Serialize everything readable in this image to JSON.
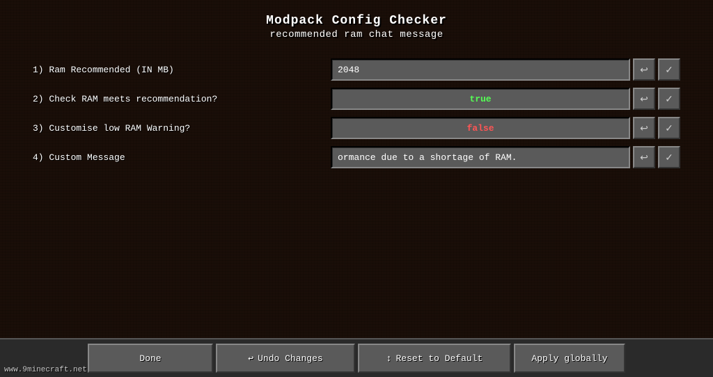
{
  "header": {
    "title": "Modpack Config Checker",
    "subtitle": "recommended ram chat message"
  },
  "rows": [
    {
      "id": "row1",
      "label": "1) Ram Recommended (IN MB)",
      "value": "2048",
      "type": "text",
      "valueClass": ""
    },
    {
      "id": "row2",
      "label": "2) Check RAM meets recommendation?",
      "value": "true",
      "type": "toggle",
      "valueClass": "value-true"
    },
    {
      "id": "row3",
      "label": "3) Customise low RAM Warning?",
      "value": "false",
      "type": "toggle",
      "valueClass": "value-false"
    },
    {
      "id": "row4",
      "label": "4) Custom Message",
      "value": "ormance due to a shortage of RAM.",
      "type": "text",
      "valueClass": ""
    }
  ],
  "buttons": {
    "done": "Done",
    "undo": "Undo Changes",
    "reset": "Reset to Default",
    "apply": "Apply globally"
  },
  "icons": {
    "undo_icon": "↩",
    "reset_icon": "↕",
    "row_undo": "↩",
    "row_check": "✓"
  },
  "watermark": "www.9minecraft.net"
}
